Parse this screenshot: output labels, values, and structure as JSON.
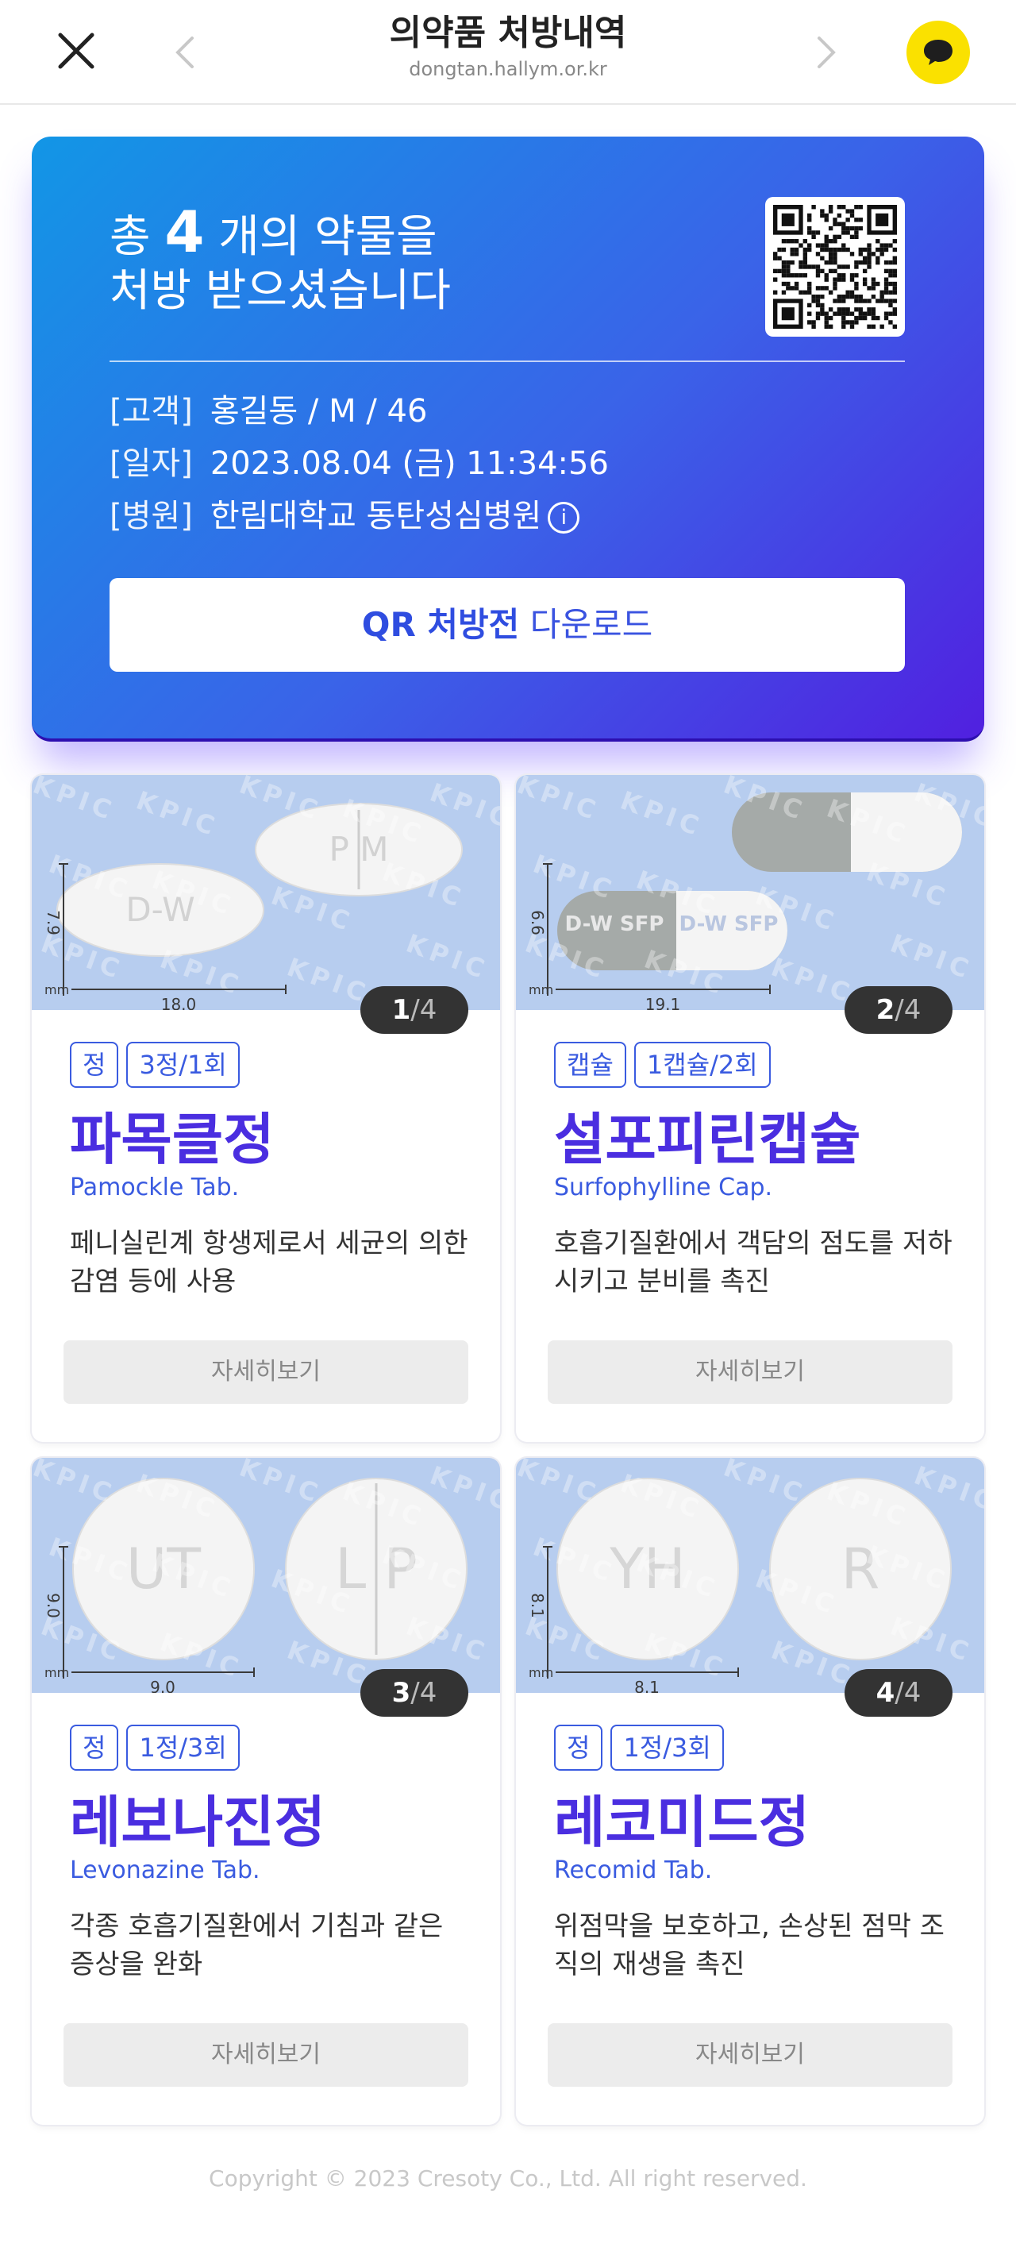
{
  "header": {
    "title": "의약품 처방내역",
    "url": "dongtan.hallym.or.kr"
  },
  "hero": {
    "headline_prefix": "총",
    "count": "4",
    "headline_suffix": "개의 약물을",
    "headline_line2": "처방 받으셨습니다",
    "customer_label": "[고객]",
    "customer_value": "홍길동 / M / 46",
    "date_label": "[일자]",
    "date_value": "2023.08.04 (금) 11:34:56",
    "hospital_label": "[병원]",
    "hospital_value": "한림대학교 동탄성심병원",
    "download_strong": "QR 처방전",
    "download_rest": "다운로드"
  },
  "cards": [
    {
      "index": "1",
      "total": "/4",
      "form": "정",
      "dose": "3정/1회",
      "name_ko": "파목클정",
      "name_en": "Pamockle Tab.",
      "description": "페니실린계 항생제로서 세균의 의한 감염 등에 사용",
      "detail_label": "자세히보기",
      "size_v": "7.9",
      "size_h": "18.0",
      "unit": "mm",
      "imprint_a": "D-W",
      "imprint_b": "P M"
    },
    {
      "index": "2",
      "total": "/4",
      "form": "캡슐",
      "dose": "1캡슐/2회",
      "name_ko": "설포피린캡슐",
      "name_en": "Surfophylline Cap.",
      "description": "호흡기질환에서 객담의 점도를 저하시키고 분비를 촉진",
      "detail_label": "자세히보기",
      "size_v": "6.6",
      "size_h": "19.1",
      "unit": "mm",
      "imprint_a": "D-W SFP",
      "imprint_b": "D-W SFP"
    },
    {
      "index": "3",
      "total": "/4",
      "form": "정",
      "dose": "1정/3회",
      "name_ko": "레보나진정",
      "name_en": "Levonazine Tab.",
      "description": "각종 호흡기질환에서 기침과 같은 증상을 완화",
      "detail_label": "자세히보기",
      "size_v": "9.0",
      "size_h": "9.0",
      "unit": "mm",
      "imprint_a": "UT",
      "imprint_b": "L P"
    },
    {
      "index": "4",
      "total": "/4",
      "form": "정",
      "dose": "1정/3회",
      "name_ko": "레코미드정",
      "name_en": "Recomid Tab.",
      "description": "위점막을 보호하고, 손상된 점막 조직의 재생을 촉진",
      "detail_label": "자세히보기",
      "size_v": "8.1",
      "size_h": "8.1",
      "unit": "mm",
      "imprint_a": "YH",
      "imprint_b": "R"
    }
  ],
  "watermark": "KPIC",
  "footer": "Copyright © 2023 Cresoty Co., Ltd. All right reserved.",
  "colors": {
    "accent": "#3a5be0",
    "drug_name": "#4a2ee0",
    "talk_button": "#fae100",
    "pill_bg": "#b7cdef"
  }
}
